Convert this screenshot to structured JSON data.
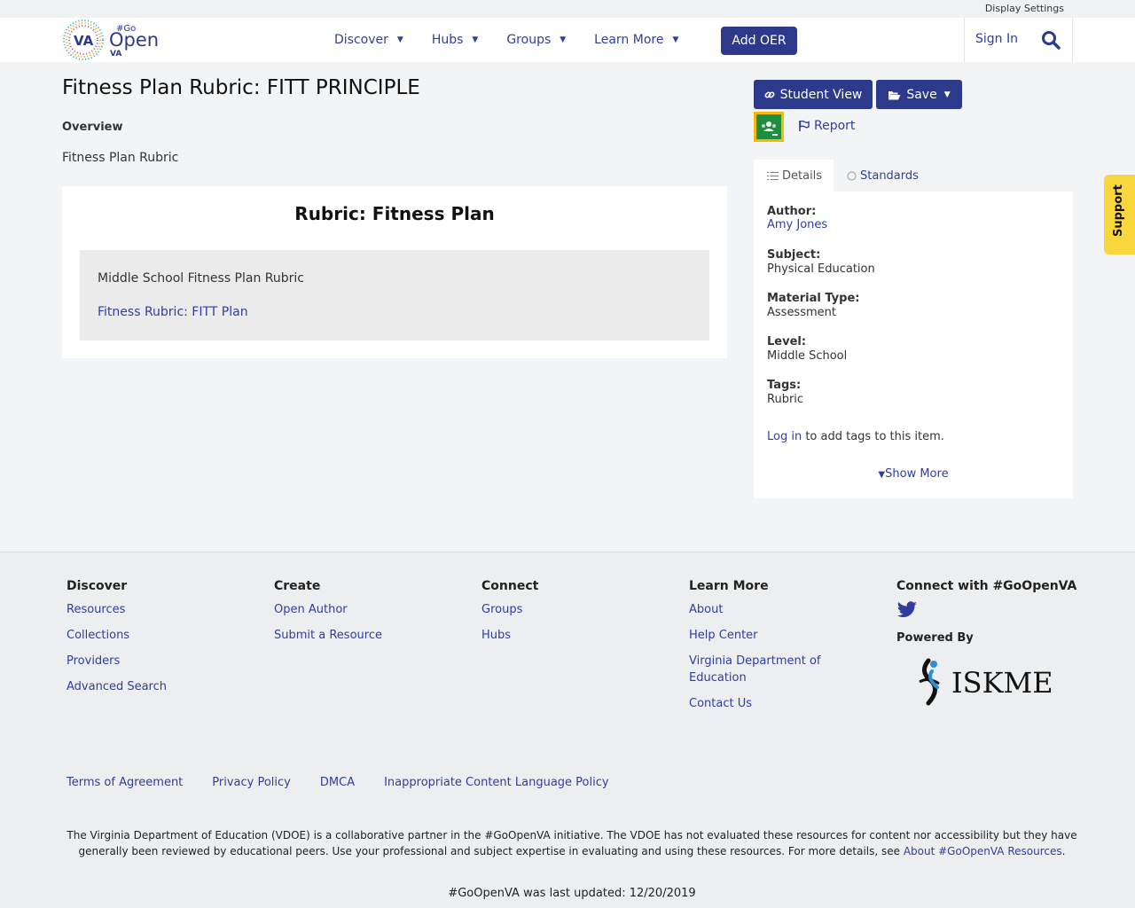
{
  "top": {
    "display_settings": "Display Settings"
  },
  "header": {
    "logo_lines": [
      "VA",
      "#Go",
      "Open",
      "VA"
    ],
    "nav": [
      {
        "label": "Discover"
      },
      {
        "label": "Hubs"
      },
      {
        "label": "Groups"
      },
      {
        "label": "Learn More"
      }
    ],
    "add_oer": "Add OER",
    "sign_in": "Sign In"
  },
  "resource": {
    "title": "Fitness Plan Rubric: FITT PRINCIPLE",
    "overview_heading": "Overview",
    "overview_text": "Fitness Plan Rubric",
    "card_title": "Rubric: Fitness Plan",
    "card_text": "Middle School Fitness Plan Rubric",
    "card_link": "Fitness Rubric: FITT Plan"
  },
  "actions": {
    "student_view": "Student View",
    "save": "Save",
    "report": "Report"
  },
  "tabs": {
    "details": "Details",
    "standards": "Standards"
  },
  "details": {
    "author_label": "Author:",
    "author": "Amy Jones",
    "subject_label": "Subject:",
    "subject": "Physical Education",
    "material_label": "Material Type:",
    "material": "Assessment",
    "level_label": "Level:",
    "level": "Middle School",
    "tags_label": "Tags:",
    "tags": "Rubric",
    "login_link": "Log in",
    "login_rest": " to add tags to this item.",
    "show_more": "Show More"
  },
  "support": "Support",
  "footer": {
    "discover": {
      "heading": "Discover",
      "links": [
        "Resources",
        "Collections",
        "Providers",
        "Advanced Search"
      ]
    },
    "create": {
      "heading": "Create",
      "links": [
        "Open Author",
        "Submit a Resource"
      ]
    },
    "connect": {
      "heading": "Connect",
      "links": [
        "Groups",
        "Hubs"
      ]
    },
    "learn": {
      "heading": "Learn More",
      "links": [
        "About",
        "Help Center",
        "Virginia Department of Education",
        "Contact Us"
      ]
    },
    "social_heading": "Connect with #GoOpenVA",
    "powered_by": "Powered By",
    "iskme": "ISKME",
    "bottom_links": [
      "Terms of Agreement",
      "Privacy Policy",
      "DMCA",
      "Inappropriate Content Language Policy"
    ],
    "disclaimer": "The Virginia Department of Education (VDOE) is a collaborative partner in the #GoOpenVA initiative. The VDOE has not evaluated these resources for content nor accessibility but they have generally been reviewed by educational peers. Use your professional and subject expertise in evaluating and using these resources. For more details, see ",
    "disclaimer_link": "About #GoOpenVA Resources",
    "disclaimer_end": ".",
    "updated": "#GoOpenVA was last updated: 12/20/2019"
  },
  "colors": {
    "primary": "#2d3a8c",
    "link": "#2f3e9e",
    "support": "#f8d63c"
  }
}
